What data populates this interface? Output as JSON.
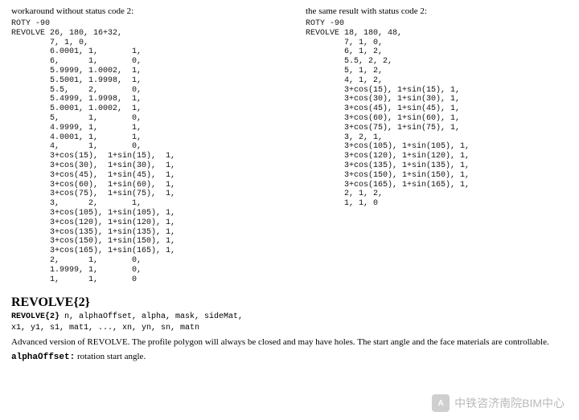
{
  "left": {
    "intro": "workaround without status code 2:",
    "code": "ROTY -90\nREVOLVE 26, 180, 16+32,\n        7, 1, 0,\n        6.0001, 1,       1,\n        6,      1,       0,\n        5.9999, 1.0002,  1,\n        5.5001, 1.9998,  1,\n        5.5,    2,       0,\n        5.4999, 1.9998,  1,\n        5.0001, 1.0002,  1,\n        5,      1,       0,\n        4.9999, 1,       1,\n        4.0001, 1,       1,\n        4,      1,       0,\n        3+cos(15),  1+sin(15),  1,\n        3+cos(30),  1+sin(30),  1,\n        3+cos(45),  1+sin(45),  1,\n        3+cos(60),  1+sin(60),  1,\n        3+cos(75),  1+sin(75),  1,\n        3,      2,       1,\n        3+cos(105), 1+sin(105), 1,\n        3+cos(120), 1+sin(120), 1,\n        3+cos(135), 1+sin(135), 1,\n        3+cos(150), 1+sin(150), 1,\n        3+cos(165), 1+sin(165), 1,\n        2,      1,       0,\n        1.9999, 1,       0,\n        1,      1,       0"
  },
  "right": {
    "intro": "the same result with status code 2:",
    "code": "ROTY -90\nREVOLVE 18, 180, 48,\n        7, 1, 0,\n        6, 1, 2,\n        5.5, 2, 2,\n        5, 1, 2,\n        4, 1, 2,\n        3+cos(15), 1+sin(15), 1,\n        3+cos(30), 1+sin(30), 1,\n        3+cos(45), 1+sin(45), 1,\n        3+cos(60), 1+sin(60), 1,\n        3+cos(75), 1+sin(75), 1,\n        3, 2, 1,\n        3+cos(105), 1+sin(105), 1,\n        3+cos(120), 1+sin(120), 1,\n        3+cos(135), 1+sin(135), 1,\n        3+cos(150), 1+sin(150), 1,\n        3+cos(165), 1+sin(165), 1,\n        2, 1, 2,\n        1, 1, 0"
  },
  "section": {
    "title": "REVOLVE{2}",
    "syntax_kw": "REVOLVE{2}",
    "syntax_rest_line1": " n, alphaOffset, alpha, mask, sideMat,",
    "syntax_rest_line2": "           x1, y1, s1, mat1, ..., xn, yn, sn, matn",
    "desc": "Advanced version of REVOLVE. The profile polygon will always be closed and may have holes. The start angle and the face materials are controllable.",
    "param_name": "alphaOffset:",
    "param_desc": " rotation start angle."
  },
  "watermark": {
    "icon": "A",
    "text": "中铁咨济南院BIM中心"
  }
}
